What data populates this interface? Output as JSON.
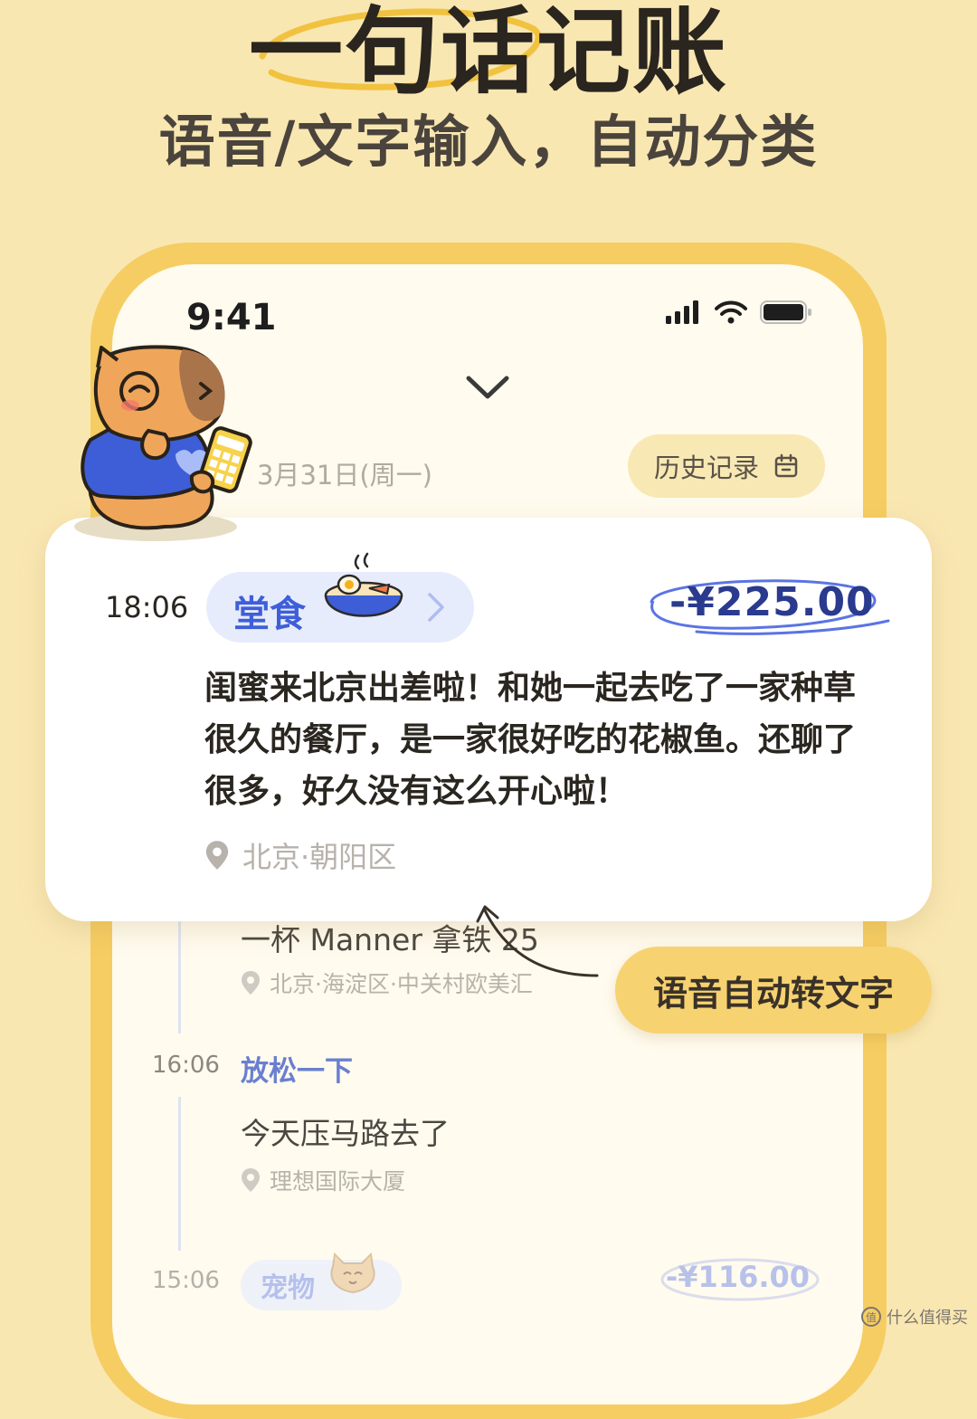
{
  "headline": {
    "title": "一句话记账",
    "subtitle": "语音/文字输入，自动分类"
  },
  "status_bar": {
    "time": "9:41"
  },
  "header": {
    "date": "3月31日(周一)",
    "history_label": "历史记录"
  },
  "featured_entry": {
    "time": "18:06",
    "category": "堂食",
    "amount": "-¥225.00",
    "description": "闺蜜来北京出差啦！和她一起去吃了一家种草很久的餐厅，是一家很好吃的花椒鱼。还聊了很多，好久没有这么开心啦！",
    "location": "北京·朝阳区"
  },
  "entries": [
    {
      "description": "一杯 Manner 拿铁 25",
      "location": "北京·海淀区·中关村欧美汇"
    },
    {
      "time": "16:06",
      "category": "放松一下",
      "description": "今天压马路去了",
      "location": "理想国际大厦"
    },
    {
      "time": "15:06",
      "category": "宠物",
      "amount": "-¥116.00"
    }
  ],
  "voice_badge": "语音自动转文字",
  "watermark": "什么值得买",
  "colors": {
    "background": "#f9e7b2",
    "accent_yellow": "#f6cd63",
    "category_blue": "#3f5fd8",
    "amount_navy": "#2a3a8e"
  }
}
